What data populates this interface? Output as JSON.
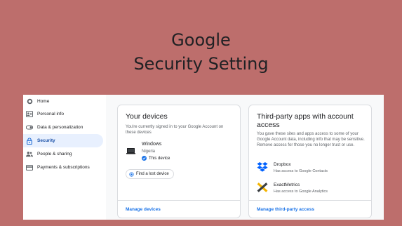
{
  "heading": {
    "line1": "Google",
    "line2": "Security Setting"
  },
  "sidebar": {
    "items": [
      {
        "label": "Home",
        "icon": "home-icon"
      },
      {
        "label": "Personal info",
        "icon": "id-card-icon"
      },
      {
        "label": "Data & personalization",
        "icon": "toggle-icon"
      },
      {
        "label": "Security",
        "icon": "lock-icon",
        "active": true
      },
      {
        "label": "People & sharing",
        "icon": "people-icon"
      },
      {
        "label": "Payments & subscriptions",
        "icon": "credit-card-icon"
      }
    ]
  },
  "devices_card": {
    "title": "Your devices",
    "description": "You're currently signed in to your Google Account on these devices",
    "device": {
      "name": "Windows",
      "location": "Nigeria",
      "status": "This device"
    },
    "find_button": "Find a lost device",
    "manage_link": "Manage devices"
  },
  "third_party_card": {
    "title_line1": "Third-party apps with account",
    "title_line2": "access",
    "description": "You gave these sites and apps access to some of your Google Account data, including info that may be sensitive. Remove access for those you no longer trust or use.",
    "apps": [
      {
        "name": "Dropbox",
        "access": "Has access to Google Contacts",
        "icon": "dropbox-icon"
      },
      {
        "name": "ExactMetrics",
        "access": "Has access to Google Analytics",
        "icon": "exactmetrics-icon"
      }
    ],
    "manage_link": "Manage third-party access"
  },
  "colors": {
    "background": "#bd6e6c",
    "accent": "#1a73e8",
    "active_nav_bg": "#e8f0fe",
    "dropbox": "#0061fe"
  }
}
